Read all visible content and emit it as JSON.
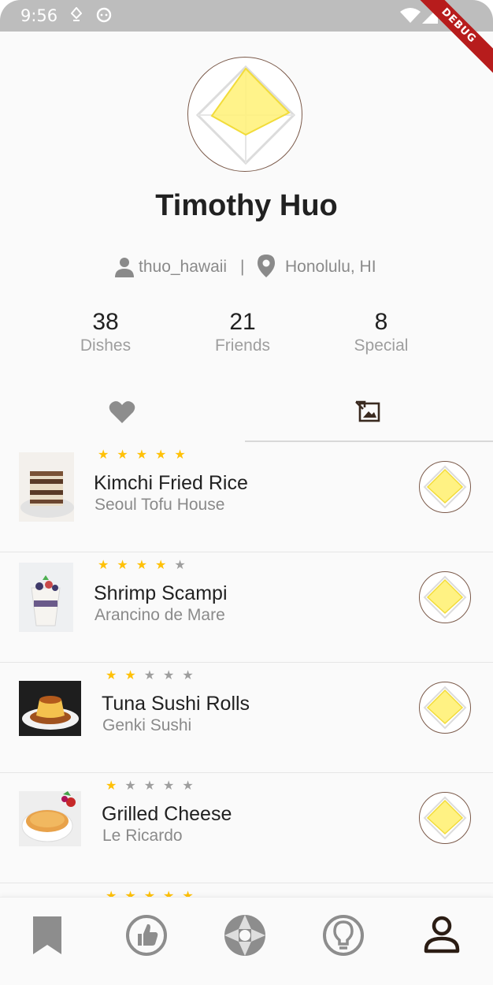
{
  "status_bar": {
    "time": "9:56",
    "debug_label": "DEBUG"
  },
  "profile": {
    "name": "Timothy Huo",
    "username": "thuo_hawaii",
    "separator": "|",
    "location": "Honolulu, HI"
  },
  "stats": [
    {
      "value": "38",
      "label": "Dishes"
    },
    {
      "value": "21",
      "label": "Friends"
    },
    {
      "value": "8",
      "label": "Special"
    }
  ],
  "tabs": [
    {
      "icon": "heart-icon",
      "selected": false
    },
    {
      "icon": "photo-swap-icon",
      "selected": true
    }
  ],
  "dishes": [
    {
      "name": "Kimchi Fried Rice",
      "place": "Seoul Tofu House",
      "rating": 5,
      "image": "tiramisu"
    },
    {
      "name": "Shrimp Scampi",
      "place": "Arancino de Mare",
      "rating": 4,
      "image": "parfait"
    },
    {
      "name": "Tuna Sushi Rolls",
      "place": "Genki Sushi",
      "rating": 2,
      "image": "flan"
    },
    {
      "name": "Grilled Cheese",
      "place": "Le Ricardo",
      "rating": 1,
      "image": "creme-brulee"
    },
    {
      "name": "",
      "place": "",
      "rating": 5,
      "image": ""
    }
  ],
  "bottom_nav": [
    {
      "icon": "bookmark-icon",
      "active": false
    },
    {
      "icon": "thumbs-up-icon",
      "active": false
    },
    {
      "icon": "camera-aperture-icon",
      "active": false
    },
    {
      "icon": "lightbulb-icon",
      "active": false
    },
    {
      "icon": "person-icon",
      "active": true
    }
  ],
  "colors": {
    "accent_gold": "#ffc107",
    "inactive_gray": "#9e9e9e",
    "ring_brown": "#7b5a4a",
    "badge_yellow": "#fff176",
    "active_dark": "#2b1d14"
  }
}
